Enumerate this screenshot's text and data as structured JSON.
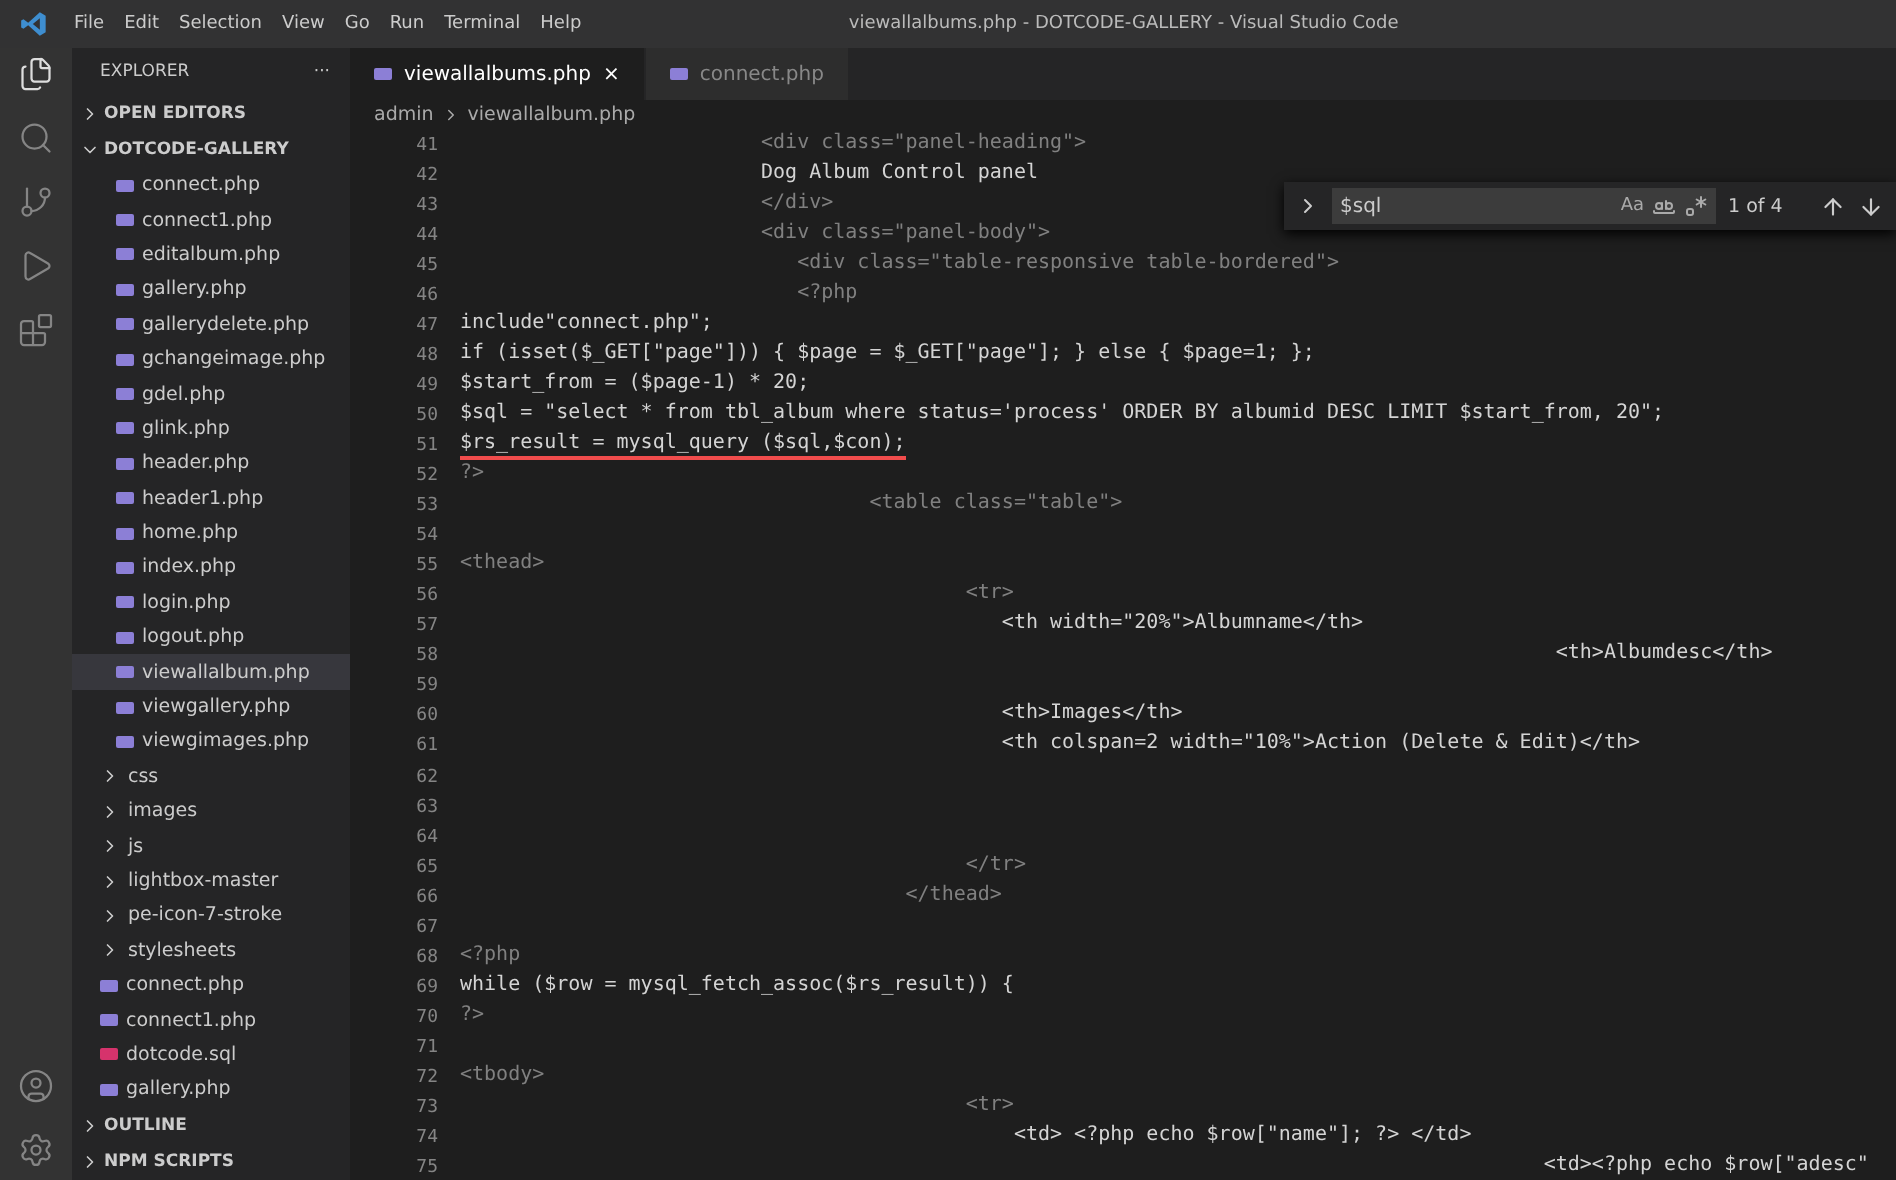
{
  "window": {
    "title": "viewallalbums.php - DOTCODE-GALLERY - Visual Studio Code"
  },
  "menu": [
    "File",
    "Edit",
    "Selection",
    "View",
    "Go",
    "Run",
    "Terminal",
    "Help"
  ],
  "sidebar": {
    "title": "EXPLORER",
    "more": "···",
    "sections": [
      {
        "label": "OPEN EDITORS",
        "expanded": false
      },
      {
        "label": "DOTCODE-GALLERY",
        "expanded": true
      }
    ],
    "nested_files": [
      {
        "name": "connect.php",
        "selected": false,
        "color": "#8c7fd6"
      },
      {
        "name": "connect1.php",
        "selected": false,
        "color": "#8c7fd6"
      },
      {
        "name": "editalbum.php",
        "selected": false,
        "color": "#8c7fd6"
      },
      {
        "name": "gallery.php",
        "selected": false,
        "color": "#8c7fd6"
      },
      {
        "name": "gallerydelete.php",
        "selected": false,
        "color": "#8c7fd6"
      },
      {
        "name": "gchangeimage.php",
        "selected": false,
        "color": "#8c7fd6"
      },
      {
        "name": "gdel.php",
        "selected": false,
        "color": "#8c7fd6"
      },
      {
        "name": "glink.php",
        "selected": false,
        "color": "#8c7fd6"
      },
      {
        "name": "header.php",
        "selected": false,
        "color": "#8c7fd6"
      },
      {
        "name": "header1.php",
        "selected": false,
        "color": "#8c7fd6"
      },
      {
        "name": "home.php",
        "selected": false,
        "color": "#8c7fd6"
      },
      {
        "name": "index.php",
        "selected": false,
        "color": "#8c7fd6"
      },
      {
        "name": "login.php",
        "selected": false,
        "color": "#8c7fd6"
      },
      {
        "name": "logout.php",
        "selected": false,
        "color": "#8c7fd6"
      },
      {
        "name": "viewallalbum.php",
        "selected": true,
        "color": "#8c7fd6"
      },
      {
        "name": "viewgallery.php",
        "selected": false,
        "color": "#8c7fd6"
      },
      {
        "name": "viewgimages.php",
        "selected": false,
        "color": "#8c7fd6"
      }
    ],
    "root_items": [
      {
        "kind": "folder",
        "name": "css"
      },
      {
        "kind": "folder",
        "name": "images"
      },
      {
        "kind": "folder",
        "name": "js"
      },
      {
        "kind": "folder",
        "name": "lightbox-master"
      },
      {
        "kind": "folder",
        "name": "pe-icon-7-stroke"
      },
      {
        "kind": "folder",
        "name": "stylesheets"
      },
      {
        "kind": "file",
        "name": "connect.php",
        "color": "#8c7fd6"
      },
      {
        "kind": "file",
        "name": "connect1.php",
        "color": "#8c7fd6"
      },
      {
        "kind": "file",
        "name": "dotcode.sql",
        "color": "#d6336c"
      },
      {
        "kind": "file",
        "name": "gallery.php",
        "color": "#8c7fd6"
      }
    ],
    "bottom_sections": [
      {
        "label": "OUTLINE",
        "expanded": false
      },
      {
        "label": "NPM SCRIPTS",
        "expanded": false
      }
    ]
  },
  "tabs": [
    {
      "label": "viewallalbums.php",
      "selected": true,
      "close": "×"
    },
    {
      "label": "connect.php",
      "selected": false
    }
  ],
  "breadcrumb": [
    "admin",
    "viewallalbum.php"
  ],
  "find": {
    "value": "$sql",
    "options": [
      "Aa"
    ],
    "count": "1 of 4"
  },
  "code": [
    {
      "n": "41",
      "kind": "html",
      "text": "                         <div class=\"panel-heading\">"
    },
    {
      "n": "42",
      "kind": "text",
      "text": "                         Dog Album Control panel"
    },
    {
      "n": "43",
      "kind": "html",
      "text": "                         </div>"
    },
    {
      "n": "44",
      "kind": "html",
      "text": "                         <div class=\"panel-body\">"
    },
    {
      "n": "45",
      "kind": "html",
      "text": "                            <div class=\"table-responsive table-bordered\">"
    },
    {
      "n": "46",
      "kind": "html",
      "text": "                            <?php"
    },
    {
      "n": "47",
      "kind": "php",
      "text": "include\"connect.php\";"
    },
    {
      "n": "48",
      "kind": "php",
      "text": "if (isset($_GET[\"page\"])) { $page = $_GET[\"page\"]; } else { $page=1; };"
    },
    {
      "n": "49",
      "kind": "php",
      "text": "$start_from = ($page-1) * 20;"
    },
    {
      "n": "50",
      "kind": "php",
      "text": "$sql = \"select * from tbl_album where status='process' ORDER BY albumid DESC LIMIT $start_from, 20\";"
    },
    {
      "n": "51",
      "kind": "php",
      "text": "$rs_result = mysql_query ($sql,$con);",
      "error": true
    },
    {
      "n": "52",
      "kind": "html",
      "text": "?>"
    },
    {
      "n": "53",
      "kind": "html",
      "text": "                                  <table class=\"table\">"
    },
    {
      "n": "54"
    },
    {
      "n": "55",
      "kind": "html",
      "text": "<thead>"
    },
    {
      "n": "56",
      "kind": "html",
      "text": "                                          <tr>"
    },
    {
      "n": "57",
      "kind": "text",
      "text": "                                             <th width=\"20%\">Albumname</th>"
    },
    {
      "n": "58",
      "kind": "text",
      "text": "                                                                                           <th>Albumdesc</th>"
    },
    {
      "n": "59"
    },
    {
      "n": "60",
      "kind": "text",
      "text": "                                             <th>Images</th>"
    },
    {
      "n": "61",
      "kind": "text",
      "text": "                                             <th colspan=2 width=\"10%\">Action (Delete & Edit)</th>"
    },
    {
      "n": "62"
    },
    {
      "n": "63"
    },
    {
      "n": "64"
    },
    {
      "n": "65",
      "kind": "html",
      "text": "                                          </tr>"
    },
    {
      "n": "66",
      "kind": "html",
      "text": "                                     </thead>"
    },
    {
      "n": "67"
    },
    {
      "n": "68",
      "kind": "html",
      "text": "<?php"
    },
    {
      "n": "69",
      "kind": "php",
      "text": "while ($row = mysql_fetch_assoc($rs_result)) {"
    },
    {
      "n": "70",
      "kind": "html",
      "text": "?>"
    },
    {
      "n": "71"
    },
    {
      "n": "72",
      "kind": "html",
      "text": "<tbody>"
    },
    {
      "n": "73",
      "kind": "html",
      "text": "                                          <tr>"
    },
    {
      "n": "74",
      "kind": "text",
      "text": "                                              <td> <?php echo $row[\"name\"]; ?> </td>"
    },
    {
      "n": "75",
      "kind": "text",
      "text": "                                                                                          <td><?php echo $row[\"adesc\""
    }
  ]
}
